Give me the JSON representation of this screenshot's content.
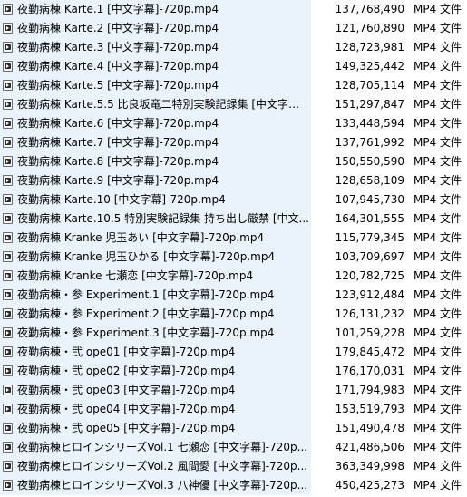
{
  "files": [
    {
      "name": "夜勤病棟 Karte.1 [中文字幕]-720p.mp4",
      "size": "137,768,490",
      "type": "MP4 文件"
    },
    {
      "name": "夜勤病棟 Karte.2 [中文字幕]-720p.mp4",
      "size": "121,760,890",
      "type": "MP4 文件"
    },
    {
      "name": "夜勤病棟 Karte.3 [中文字幕]-720p.mp4",
      "size": "128,723,981",
      "type": "MP4 文件"
    },
    {
      "name": "夜勤病棟 Karte.4 [中文字幕]-720p.mp4",
      "size": "149,325,442",
      "type": "MP4 文件"
    },
    {
      "name": "夜勤病棟 Karte.5 [中文字幕]-720p.mp4",
      "size": "128,705,114",
      "type": "MP4 文件"
    },
    {
      "name": "夜勤病棟 Karte.5.5 比良坂竜二特別実験記録集 [中文字幕]...",
      "size": "151,297,847",
      "type": "MP4 文件"
    },
    {
      "name": "夜勤病棟 Karte.6 [中文字幕]-720p.mp4",
      "size": "133,448,594",
      "type": "MP4 文件"
    },
    {
      "name": "夜勤病棟 Karte.7 [中文字幕]-720p.mp4",
      "size": "137,761,992",
      "type": "MP4 文件"
    },
    {
      "name": "夜勤病棟 Karte.8 [中文字幕]-720p.mp4",
      "size": "150,550,590",
      "type": "MP4 文件"
    },
    {
      "name": "夜勤病棟 Karte.9 [中文字幕]-720p.mp4",
      "size": "128,658,109",
      "type": "MP4 文件"
    },
    {
      "name": "夜勤病棟 Karte.10 [中文字幕]-720p.mp4",
      "size": "107,945,730",
      "type": "MP4 文件"
    },
    {
      "name": "夜勤病棟 Karte.10.5 特別実験記録集 持ち出し厳禁 [中文...",
      "size": "164,301,555",
      "type": "MP4 文件"
    },
    {
      "name": "夜勤病棟 Kranke 児玉あい [中文字幕]-720p.mp4",
      "size": "115,779,345",
      "type": "MP4 文件"
    },
    {
      "name": "夜勤病棟 Kranke 児玉ひかる [中文字幕]-720p.mp4",
      "size": "103,709,697",
      "type": "MP4 文件"
    },
    {
      "name": "夜勤病棟 Kranke 七瀬恋 [中文字幕]-720p.mp4",
      "size": "120,782,725",
      "type": "MP4 文件"
    },
    {
      "name": "夜勤病棟・参 Experiment.1 [中文字幕]-720p.mp4",
      "size": "123,912,484",
      "type": "MP4 文件"
    },
    {
      "name": "夜勤病棟・参 Experiment.2 [中文字幕]-720p.mp4",
      "size": "126,131,232",
      "type": "MP4 文件"
    },
    {
      "name": "夜勤病棟・参 Experiment.3 [中文字幕]-720p.mp4",
      "size": "101,259,228",
      "type": "MP4 文件"
    },
    {
      "name": "夜勤病棟・弐 ope01 [中文字幕]-720p.mp4",
      "size": "179,845,472",
      "type": "MP4 文件"
    },
    {
      "name": "夜勤病棟・弐 ope02 [中文字幕]-720p.mp4",
      "size": "176,170,031",
      "type": "MP4 文件"
    },
    {
      "name": "夜勤病棟・弐 ope03 [中文字幕]-720p.mp4",
      "size": "171,794,983",
      "type": "MP4 文件"
    },
    {
      "name": "夜勤病棟・弐 ope04 [中文字幕]-720p.mp4",
      "size": "153,519,793",
      "type": "MP4 文件"
    },
    {
      "name": "夜勤病棟・弐 ope05 [中文字幕]-720p.mp4",
      "size": "151,490,478",
      "type": "MP4 文件"
    },
    {
      "name": "夜勤病棟ヒロインシリーズVol.1 七瀬恋 [中文字幕]-720p...",
      "size": "421,486,506",
      "type": "MP4 文件"
    },
    {
      "name": "夜勤病棟ヒロインシリーズVol.2 風間愛 [中文字幕]-720p...",
      "size": "363,349,998",
      "type": "MP4 文件"
    },
    {
      "name": "夜勤病棟ヒロインシリーズVol.3 八神優 [中文字幕]-720p...",
      "size": "450,425,273",
      "type": "MP4 文件"
    }
  ]
}
